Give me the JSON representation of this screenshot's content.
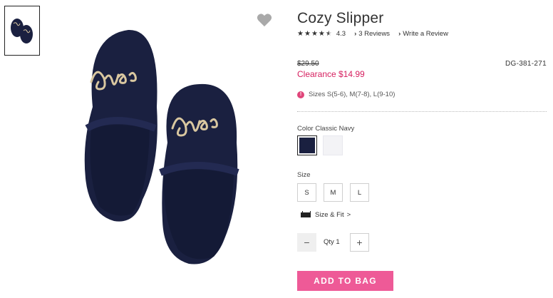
{
  "product": {
    "title": "Cozy Slipper",
    "rating": "4.3",
    "stars_filled": 4.3,
    "reviews_link": "3 Reviews",
    "write_review_link": "Write a Review",
    "old_price": "$29.50",
    "sale_price": "Clearance $14.99",
    "sku": "DG-381-271",
    "sizes_note": "Sizes S(5-6), M(7-8), L(9-10)",
    "alert_glyph": "!"
  },
  "color": {
    "label": "Color Classic Navy",
    "swatches": [
      {
        "name": "Classic Navy",
        "hex": "#1a2040"
      },
      {
        "name": "White",
        "hex": "#f3f3f6"
      }
    ]
  },
  "size": {
    "label": "Size",
    "options": [
      "S",
      "M",
      "L"
    ],
    "fit_link": "Size & Fit",
    "fit_chevron": ">"
  },
  "quantity": {
    "minus": "−",
    "plus": "+",
    "label": "Qty 1"
  },
  "actions": {
    "add_to_bag": "ADD TO BAG"
  },
  "colors": {
    "accent_pink": "#ee5a97",
    "clearance_red": "#d61f5f",
    "slipper_navy": "#1a2040",
    "embroidery_gold": "#d9c7a0"
  },
  "icons": {
    "favorite": "heart-icon",
    "ruler": "ruler-icon",
    "chevron": "chevron-right-icon",
    "alert": "alert-circle-icon"
  }
}
